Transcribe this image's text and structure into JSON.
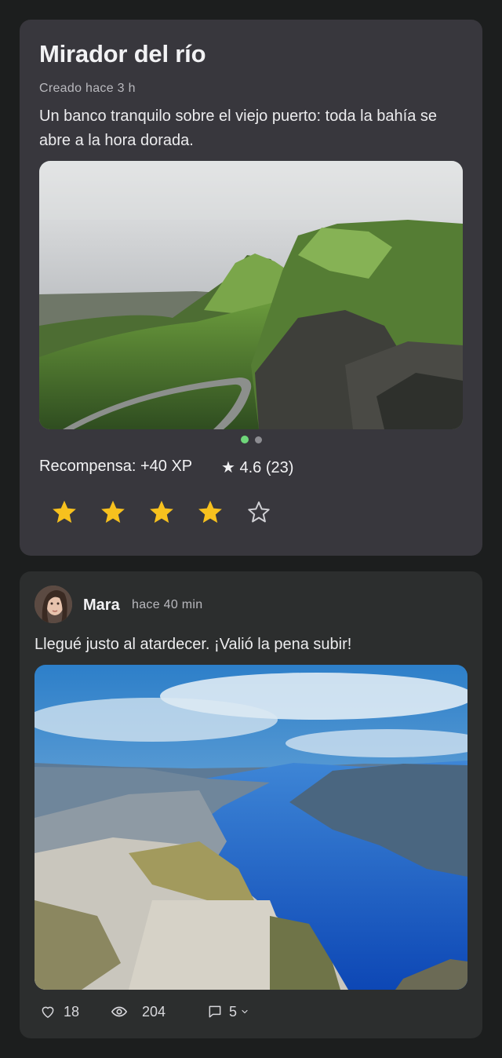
{
  "spot_card": {
    "title": "Mirador del río",
    "created": "Creado hace 3 h",
    "description": "Un banco tranquilo sobre el viejo puerto: toda la bahía se abre a la hora dorada.",
    "photo_icon": "landscape-photo-green-cliffs",
    "carousel": {
      "pages": 2,
      "current": 1
    },
    "reward": "Recompensa: +40 XP",
    "rating_summary": "★ 4.6 (23)",
    "user_rating": {
      "value": 4,
      "max": 5
    },
    "accent_color": "#f7c11e",
    "dot_active_color": "#6fd67a"
  },
  "post": {
    "avatar_icon": "avatar-photo",
    "author": "Mara",
    "time": "hace 40 min",
    "text": "Llegué justo al atardecer. ¡Valió la pena subir!",
    "photo_icon": "landscape-photo-fjord",
    "likes": "18",
    "views": "204",
    "comments": "5",
    "like_icon": "heart-icon",
    "views_icon": "eye-icon",
    "comments_icon": "comment-icon"
  }
}
